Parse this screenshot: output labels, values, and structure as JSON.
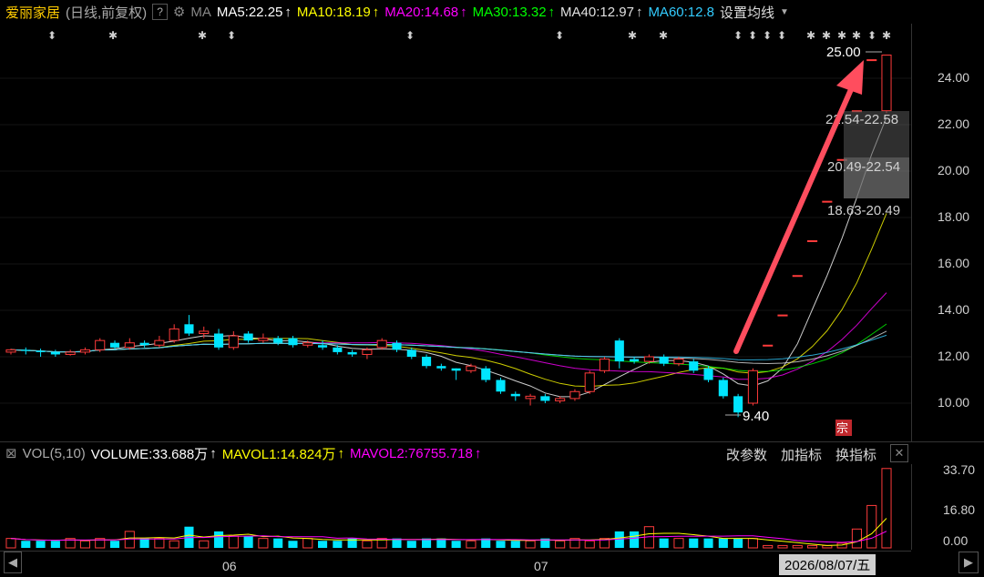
{
  "header": {
    "stock_name": "爱丽家居",
    "mode": "(日线,前复权)",
    "help_label": "?",
    "gear_icon": "gear-icon",
    "ma_label": "MA",
    "ma5": "MA5:22.25",
    "ma10": "MA10:18.19",
    "ma20": "MA20:14.68",
    "ma30": "MA30:13.32",
    "ma40": "MA40:12.97",
    "ma60": "MA60:12.8",
    "settings": "设置均线",
    "colors": {
      "ma5": "#ffffff",
      "ma10": "#ffff00",
      "ma20": "#ff00ff",
      "ma30": "#00ff00",
      "ma40": "#e0e0e0",
      "ma60": "#33ccff"
    }
  },
  "price_axis": {
    "ticks": [
      "24.00",
      "22.00",
      "20.00",
      "18.00",
      "16.00",
      "14.00",
      "12.00",
      "10.00"
    ]
  },
  "annotations": {
    "high_label": "25.00",
    "low_label": "9.40",
    "chip_1": "22.54-22.58",
    "chip_2": "20.49-22.54",
    "chip_3": "18.63-20.49",
    "badge": "宗"
  },
  "volume_header": {
    "checkbox": "⊠",
    "vol_label": "VOL(5,10)",
    "volume": "VOLUME:33.688万",
    "mavol1": "MAVOL1:14.824万",
    "mavol2": "MAVOL2:76755.718",
    "btn_change": "改参数",
    "btn_add": "加指标",
    "btn_switch": "换指标",
    "btn_close": "✕"
  },
  "volume_axis": {
    "ticks": [
      "33.70",
      "16.80",
      "0.00"
    ]
  },
  "time_axis": {
    "labels": [
      "06",
      "07"
    ],
    "current_date": "2026/08/07/五"
  },
  "chart_data": {
    "type": "candlestick",
    "ylim": [
      9.0,
      25.5
    ],
    "candles": [
      [
        12.2,
        12.3,
        12.1,
        12.35
      ],
      [
        12.3,
        12.25,
        12.1,
        12.4
      ],
      [
        12.25,
        12.2,
        12.0,
        12.35
      ],
      [
        12.2,
        12.1,
        12.0,
        12.3
      ],
      [
        12.1,
        12.2,
        12.05,
        12.3
      ],
      [
        12.2,
        12.3,
        12.1,
        12.4
      ],
      [
        12.3,
        12.7,
        12.2,
        12.8
      ],
      [
        12.6,
        12.4,
        12.3,
        12.7
      ],
      [
        12.4,
        12.6,
        12.3,
        12.8
      ],
      [
        12.6,
        12.5,
        12.4,
        12.7
      ],
      [
        12.5,
        12.7,
        12.4,
        12.9
      ],
      [
        12.7,
        13.2,
        12.6,
        13.4
      ],
      [
        13.4,
        13.0,
        12.9,
        13.8
      ],
      [
        13.0,
        13.1,
        12.8,
        13.3
      ],
      [
        13.0,
        12.4,
        12.3,
        13.2
      ],
      [
        12.4,
        12.9,
        12.3,
        13.1
      ],
      [
        13.0,
        12.7,
        12.6,
        13.1
      ],
      [
        12.7,
        12.8,
        12.6,
        13.0
      ],
      [
        12.8,
        12.6,
        12.5,
        12.9
      ],
      [
        12.8,
        12.5,
        12.4,
        12.9
      ],
      [
        12.5,
        12.6,
        12.4,
        12.7
      ],
      [
        12.5,
        12.4,
        12.3,
        12.7
      ],
      [
        12.4,
        12.2,
        12.1,
        12.5
      ],
      [
        12.2,
        12.1,
        12.0,
        12.3
      ],
      [
        12.1,
        12.3,
        11.9,
        12.4
      ],
      [
        12.4,
        12.7,
        12.3,
        12.8
      ],
      [
        12.6,
        12.3,
        12.2,
        12.7
      ],
      [
        12.3,
        12.0,
        11.9,
        12.4
      ],
      [
        12.0,
        11.6,
        11.5,
        12.1
      ],
      [
        11.6,
        11.5,
        11.4,
        11.7
      ],
      [
        11.5,
        11.4,
        11.0,
        11.5
      ],
      [
        11.4,
        11.6,
        11.3,
        11.7
      ],
      [
        11.5,
        11.0,
        10.9,
        11.6
      ],
      [
        11.0,
        10.5,
        10.4,
        11.1
      ],
      [
        10.4,
        10.3,
        10.1,
        10.5
      ],
      [
        10.2,
        10.3,
        9.9,
        10.4
      ],
      [
        10.3,
        10.1,
        10.0,
        10.4
      ],
      [
        10.1,
        10.2,
        10.0,
        10.3
      ],
      [
        10.2,
        10.5,
        10.1,
        10.6
      ],
      [
        10.5,
        11.3,
        10.4,
        11.4
      ],
      [
        11.4,
        11.9,
        11.3,
        12.0
      ],
      [
        12.7,
        11.8,
        11.5,
        12.8
      ],
      [
        11.9,
        11.8,
        11.7,
        12.0
      ],
      [
        11.8,
        12.0,
        11.7,
        12.1
      ],
      [
        12.0,
        11.7,
        11.6,
        12.1
      ],
      [
        11.7,
        11.9,
        11.6,
        12.0
      ],
      [
        11.8,
        11.4,
        11.3,
        11.9
      ],
      [
        11.5,
        11.0,
        10.9,
        11.6
      ],
      [
        11.0,
        10.3,
        10.2,
        11.1
      ],
      [
        10.3,
        9.6,
        9.4,
        10.4
      ],
      [
        10.0,
        11.4,
        9.9,
        11.5
      ],
      [
        12.5,
        12.5,
        12.5,
        12.5
      ],
      [
        13.8,
        13.8,
        13.8,
        13.8
      ],
      [
        15.5,
        15.5,
        15.5,
        15.5
      ],
      [
        17.0,
        17.0,
        17.0,
        17.0
      ],
      [
        18.7,
        18.7,
        18.7,
        18.7
      ],
      [
        20.5,
        20.5,
        20.5,
        20.5
      ],
      [
        22.6,
        22.6,
        22.6,
        22.6
      ],
      [
        24.8,
        24.8,
        24.8,
        24.8
      ],
      [
        22.6,
        25.0,
        22.5,
        25.0
      ]
    ],
    "volumes": [
      4,
      3,
      3,
      3,
      4,
      3,
      4,
      3,
      7,
      4,
      4,
      3,
      9,
      3,
      7,
      5,
      5,
      4,
      4,
      3,
      4,
      3,
      3,
      4,
      3,
      4,
      4,
      3,
      4,
      4,
      3,
      3,
      4,
      3,
      3,
      3,
      4,
      3,
      4,
      3,
      4,
      7,
      7,
      9,
      4,
      4,
      4,
      4,
      4,
      4,
      4,
      1,
      1,
      1,
      1,
      1,
      2,
      8,
      18,
      33.7
    ],
    "volume_ylim": [
      0,
      34
    ]
  }
}
